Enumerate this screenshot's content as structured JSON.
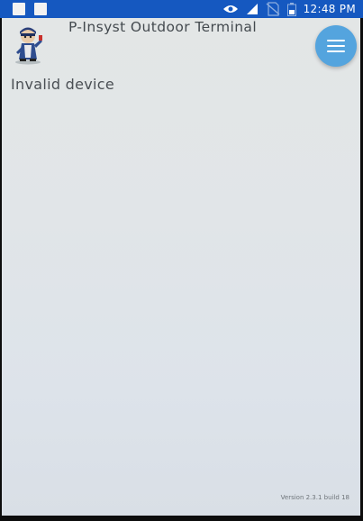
{
  "status_bar": {
    "time": "12:48 PM",
    "icons": [
      "notification-icon",
      "notification-icon",
      "eye-icon",
      "signal-icon",
      "no-sim-icon",
      "battery-icon"
    ]
  },
  "app": {
    "title": "P-Insyst Outdoor Terminal",
    "logo_icon": "mascot-logo-icon",
    "menu_icon": "hamburger-menu-icon"
  },
  "content": {
    "message": "Invalid device"
  },
  "footer": {
    "version": "Version 2.3.1 build 18"
  },
  "colors": {
    "status_bar": "#1558c0",
    "menu_button": "#54a4de",
    "screen_bg": "#e1e5e8",
    "text": "#4a4f54"
  }
}
